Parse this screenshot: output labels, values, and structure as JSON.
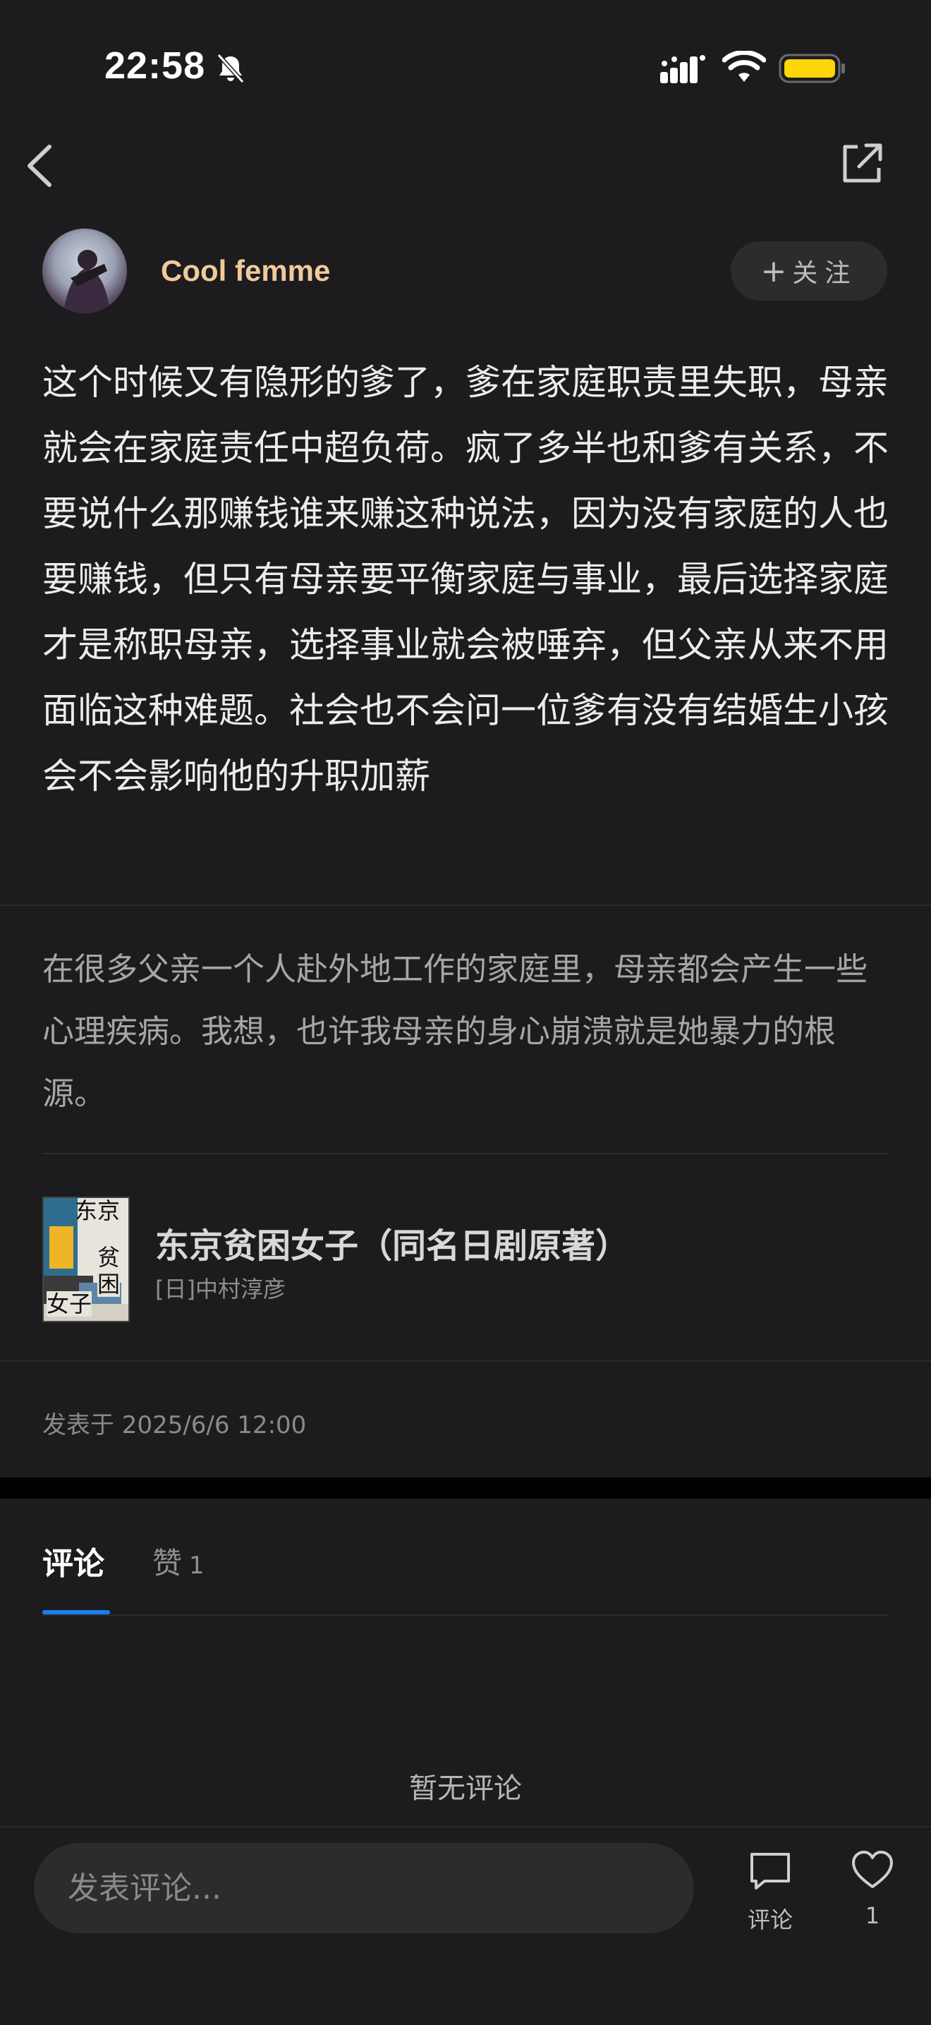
{
  "status_bar": {
    "time": "22:58"
  },
  "nav": {
    "back_icon": "chevron-left-icon",
    "share_icon": "share-external-icon"
  },
  "author": {
    "name": "Cool femme",
    "follow_label": "关注",
    "follow_plus": "+"
  },
  "post": {
    "text": "这个时候又有隐形的爹了，爹在家庭职责里失职，母亲就会在家庭责任中超负荷。疯了多半也和爹有关系，不要说什么那赚钱谁来赚这种说法，因为没有家庭的人也要赚钱，但只有母亲要平衡家庭与事业，最后选择家庭才是称职母亲，选择事业就会被唾弃，但父亲从来不用面临这种难题。社会也不会问一位爹有没有结婚生小孩会不会影响他的升职加薪",
    "quote": "在很多父亲一个人赴外地工作的家庭里，母亲都会产生一些心理疾病。我想，也许我母亲的身心崩溃就是她暴力的根源。",
    "published": "发表于 2025/6/6 12:00"
  },
  "book": {
    "title": "东京贫困女子（同名日剧原著）",
    "author": "[日]中村淳彦",
    "cover_text": [
      "东京",
      "贫",
      "困",
      "女子"
    ]
  },
  "tabs": {
    "comments_label": "评论",
    "likes_label": "赞",
    "likes_count": "1"
  },
  "comments": {
    "empty_text": "暂无评论"
  },
  "bottom_bar": {
    "input_placeholder": "发表评论...",
    "comment_label": "评论",
    "like_count": "1"
  },
  "colors": {
    "background": "#1c1c1e",
    "author_name": "#f2c99c",
    "tab_accent": "#1a7ef2",
    "battery": "#ffd60a"
  }
}
